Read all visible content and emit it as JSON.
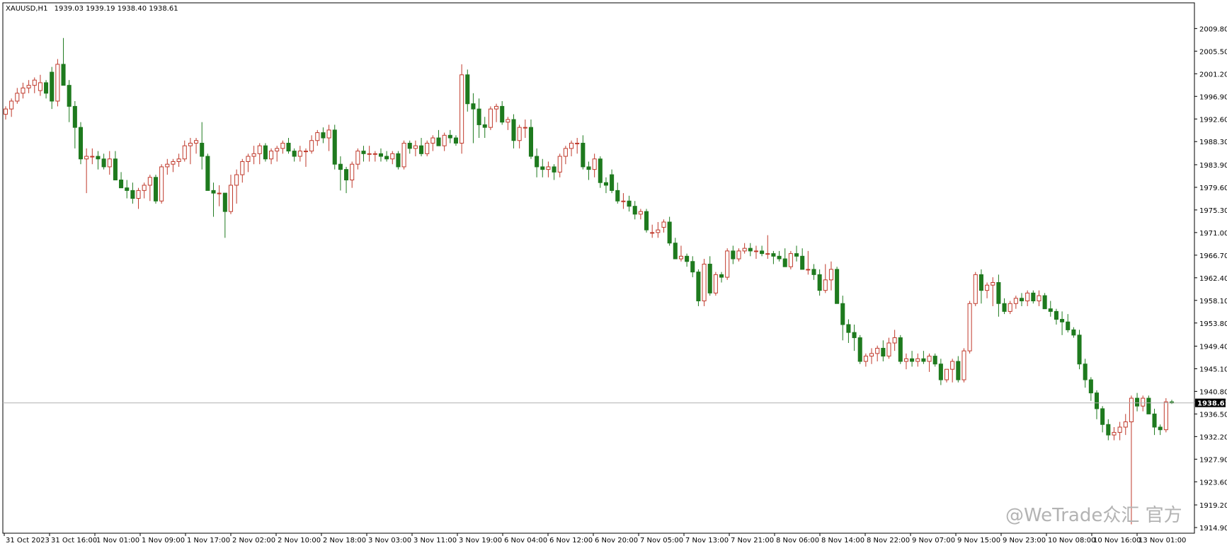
{
  "header": {
    "symbol": "XAUUSD,H1",
    "ohlc": "1939.03 1939.19 1938.40 1938.61"
  },
  "current_price_label": "1938.61",
  "watermark": "@WeTrade众汇 官方",
  "colors": {
    "bull": "#ffffff",
    "bull_border": "#c0392b",
    "bear": "#1e7a1e",
    "bear_border": "#1e7a1e",
    "current_line": "#b0b0b0",
    "price_box": "#000000"
  },
  "chart_data": {
    "type": "candlestick",
    "symbol": "XAUUSD",
    "timeframe": "H1",
    "ylim": [
      1914.9,
      2012.0
    ],
    "y_ticks": [
      "2009.80",
      "2005.50",
      "2001.20",
      "1996.90",
      "1992.60",
      "1988.30",
      "1983.90",
      "1979.60",
      "1975.30",
      "1971.00",
      "1966.70",
      "1962.40",
      "1958.10",
      "1953.80",
      "1949.40",
      "1945.10",
      "1940.80",
      "1936.50",
      "1932.20",
      "1927.90",
      "1923.60",
      "1919.20",
      "1914.90"
    ],
    "x_ticks": [
      "31 Oct 2023",
      "31 Oct 16:00",
      "1 Nov 01:00",
      "1 Nov 09:00",
      "1 Nov 17:00",
      "2 Nov 02:00",
      "2 Nov 10:00",
      "2 Nov 18:00",
      "3 Nov 03:00",
      "3 Nov 11:00",
      "3 Nov 19:00",
      "6 Nov 04:00",
      "6 Nov 12:00",
      "6 Nov 20:00",
      "7 Nov 05:00",
      "7 Nov 13:00",
      "7 Nov 21:00",
      "8 Nov 06:00",
      "8 Nov 14:00",
      "8 Nov 22:00",
      "9 Nov 07:00",
      "9 Nov 15:00",
      "9 Nov 23:00",
      "10 Nov 08:00",
      "10 Nov 16:00",
      "13 Nov 01:00"
    ],
    "current_price": 1938.61,
    "candles": [
      [
        1993.5,
        1995.0,
        1992.5,
        1994.5
      ],
      [
        1994.5,
        1996.5,
        1993.0,
        1996.0
      ],
      [
        1996.0,
        1998.5,
        1995.5,
        1997.5
      ],
      [
        1997.5,
        1999.5,
        1996.5,
        1998.5
      ],
      [
        1998.5,
        2000.0,
        1997.5,
        1999.0
      ],
      [
        1999.0,
        2000.5,
        1997.5,
        2000.0
      ],
      [
        1998.0,
        2001.0,
        1997.0,
        1999.5
      ],
      [
        1999.5,
        2000.0,
        1996.5,
        1997.5
      ],
      [
        2001.5,
        2002.5,
        1994.5,
        1996.0
      ],
      [
        1996.0,
        2004.0,
        1995.0,
        2003.0
      ],
      [
        2003.0,
        2008.0,
        1999.0,
        1999.0
      ],
      [
        1999.0,
        2000.0,
        1992.0,
        1995.0
      ],
      [
        1995.0,
        1996.0,
        1987.0,
        1991.0
      ],
      [
        1991.0,
        1992.0,
        1984.0,
        1985.0
      ],
      [
        1985.0,
        1987.0,
        1978.5,
        1985.5
      ],
      [
        1985.5,
        1987.0,
        1984.0,
        1985.5
      ],
      [
        1985.5,
        1986.5,
        1983.0,
        1985.0
      ],
      [
        1985.0,
        1986.0,
        1983.0,
        1983.5
      ],
      [
        1983.5,
        1986.5,
        1982.0,
        1985.0
      ],
      [
        1985.0,
        1986.5,
        1981.0,
        1981.0
      ],
      [
        1981.0,
        1982.5,
        1979.5,
        1979.5
      ],
      [
        1979.5,
        1981.0,
        1977.5,
        1979.0
      ],
      [
        1979.0,
        1980.5,
        1976.5,
        1977.5
      ],
      [
        1977.5,
        1979.5,
        1975.5,
        1979.0
      ],
      [
        1979.0,
        1980.5,
        1977.5,
        1980.0
      ],
      [
        1980.0,
        1982.0,
        1977.0,
        1981.5
      ],
      [
        1981.5,
        1982.0,
        1976.5,
        1977.0
      ],
      [
        1977.0,
        1984.0,
        1976.5,
        1983.5
      ],
      [
        1983.5,
        1985.0,
        1982.0,
        1984.0
      ],
      [
        1984.0,
        1985.0,
        1982.5,
        1984.5
      ],
      [
        1984.5,
        1986.0,
        1983.5,
        1985.0
      ],
      [
        1985.0,
        1988.5,
        1984.5,
        1987.5
      ],
      [
        1987.5,
        1989.0,
        1984.0,
        1988.0
      ],
      [
        1988.0,
        1989.0,
        1986.0,
        1988.5
      ],
      [
        1988.0,
        1992.0,
        1983.0,
        1985.5
      ],
      [
        1985.5,
        1986.0,
        1980.0,
        1979.0
      ],
      [
        1979.0,
        1980.5,
        1974.0,
        1978.5
      ],
      [
        1978.5,
        1980.0,
        1976.0,
        1978.5
      ],
      [
        1978.5,
        1978.5,
        1970.0,
        1975.0
      ],
      [
        1975.0,
        1982.0,
        1974.5,
        1980.0
      ],
      [
        1980.0,
        1983.0,
        1976.5,
        1982.0
      ],
      [
        1982.0,
        1985.0,
        1980.5,
        1984.5
      ],
      [
        1984.5,
        1986.0,
        1982.5,
        1985.5
      ],
      [
        1985.5,
        1987.5,
        1984.0,
        1986.0
      ],
      [
        1986.0,
        1988.0,
        1984.0,
        1987.5
      ],
      [
        1987.5,
        1988.0,
        1984.5,
        1985.0
      ],
      [
        1985.0,
        1987.0,
        1984.0,
        1986.5
      ],
      [
        1986.5,
        1987.5,
        1984.5,
        1987.0
      ],
      [
        1987.0,
        1988.5,
        1986.0,
        1988.0
      ],
      [
        1988.0,
        1989.0,
        1986.0,
        1986.5
      ],
      [
        1986.5,
        1987.0,
        1984.5,
        1985.5
      ],
      [
        1985.5,
        1987.5,
        1984.5,
        1986.5
      ],
      [
        1986.5,
        1987.0,
        1983.5,
        1986.5
      ],
      [
        1986.5,
        1989.5,
        1986.0,
        1988.5
      ],
      [
        1988.5,
        1990.5,
        1987.5,
        1990.0
      ],
      [
        1990.0,
        1991.0,
        1988.0,
        1989.0
      ],
      [
        1989.0,
        1991.5,
        1986.5,
        1990.5
      ],
      [
        1990.5,
        1991.5,
        1983.0,
        1984.0
      ],
      [
        1984.0,
        1985.5,
        1979.0,
        1983.0
      ],
      [
        1983.0,
        1983.5,
        1978.5,
        1981.0
      ],
      [
        1981.0,
        1984.5,
        1979.5,
        1984.0
      ],
      [
        1984.0,
        1987.0,
        1983.0,
        1986.5
      ],
      [
        1986.5,
        1987.5,
        1984.5,
        1986.0
      ],
      [
        1986.0,
        1987.5,
        1984.5,
        1986.0
      ],
      [
        1986.0,
        1986.5,
        1984.5,
        1986.0
      ],
      [
        1986.0,
        1987.0,
        1984.5,
        1985.5
      ],
      [
        1985.5,
        1986.5,
        1984.5,
        1985.0
      ],
      [
        1985.0,
        1986.5,
        1984.0,
        1986.0
      ],
      [
        1986.0,
        1986.5,
        1983.0,
        1983.5
      ],
      [
        1983.5,
        1988.5,
        1983.0,
        1988.0
      ],
      [
        1988.0,
        1988.5,
        1986.0,
        1987.0
      ],
      [
        1987.0,
        1988.5,
        1985.5,
        1987.5
      ],
      [
        1987.5,
        1989.0,
        1985.5,
        1986.0
      ],
      [
        1986.0,
        1988.5,
        1985.5,
        1988.0
      ],
      [
        1988.0,
        1989.5,
        1986.5,
        1989.0
      ],
      [
        1989.0,
        1990.5,
        1987.5,
        1987.5
      ],
      [
        1987.5,
        1990.0,
        1986.5,
        1989.5
      ],
      [
        1989.5,
        1990.5,
        1988.0,
        1989.0
      ],
      [
        1989.0,
        1989.5,
        1987.5,
        1988.0
      ],
      [
        1988.0,
        2003.0,
        1986.0,
        2001.0
      ],
      [
        2001.0,
        2002.0,
        1994.0,
        1995.5
      ],
      [
        1995.5,
        1997.5,
        1988.0,
        1994.5
      ],
      [
        1994.5,
        1996.5,
        1989.0,
        1991.5
      ],
      [
        1991.5,
        1993.0,
        1989.0,
        1991.0
      ],
      [
        1991.0,
        1995.0,
        1990.5,
        1994.5
      ],
      [
        1994.5,
        1995.5,
        1992.0,
        1995.0
      ],
      [
        1995.0,
        1996.0,
        1991.5,
        1992.0
      ],
      [
        1992.0,
        1993.0,
        1990.5,
        1992.5
      ],
      [
        1992.5,
        1993.5,
        1987.0,
        1988.5
      ],
      [
        1988.5,
        1991.5,
        1987.0,
        1991.0
      ],
      [
        1991.0,
        1992.5,
        1989.0,
        1991.0
      ],
      [
        1991.0,
        1992.5,
        1985.0,
        1985.5
      ],
      [
        1985.5,
        1987.0,
        1981.5,
        1983.5
      ],
      [
        1983.5,
        1985.0,
        1981.5,
        1983.0
      ],
      [
        1983.0,
        1984.5,
        1981.5,
        1983.5
      ],
      [
        1983.5,
        1984.0,
        1981.0,
        1982.5
      ],
      [
        1982.5,
        1986.0,
        1981.5,
        1985.5
      ],
      [
        1985.5,
        1987.5,
        1984.0,
        1987.0
      ],
      [
        1987.0,
        1988.5,
        1985.5,
        1988.0
      ],
      [
        1988.0,
        1989.0,
        1986.0,
        1988.0
      ],
      [
        1988.0,
        1989.5,
        1983.0,
        1983.5
      ],
      [
        1983.5,
        1984.5,
        1981.0,
        1983.0
      ],
      [
        1983.0,
        1986.0,
        1981.5,
        1985.0
      ],
      [
        1985.0,
        1985.5,
        1979.5,
        1980.5
      ],
      [
        1980.5,
        1981.5,
        1978.5,
        1980.0
      ],
      [
        1982.0,
        1983.0,
        1978.5,
        1979.0
      ],
      [
        1979.0,
        1980.5,
        1976.5,
        1977.0
      ],
      [
        1977.0,
        1978.5,
        1975.5,
        1977.0
      ],
      [
        1977.0,
        1978.0,
        1975.0,
        1976.0
      ],
      [
        1976.0,
        1977.0,
        1973.5,
        1974.5
      ],
      [
        1974.5,
        1975.5,
        1973.5,
        1975.0
      ],
      [
        1975.0,
        1975.5,
        1971.0,
        1971.5
      ],
      [
        1971.0,
        1972.5,
        1970.0,
        1971.0
      ],
      [
        1971.0,
        1973.0,
        1970.0,
        1971.5
      ],
      [
        1972.0,
        1973.5,
        1971.0,
        1973.0
      ],
      [
        1973.0,
        1974.0,
        1968.5,
        1969.0
      ],
      [
        1969.0,
        1970.0,
        1966.0,
        1966.0
      ],
      [
        1966.0,
        1968.5,
        1965.5,
        1966.5
      ],
      [
        1966.5,
        1967.0,
        1964.5,
        1965.5
      ],
      [
        1965.5,
        1966.5,
        1962.5,
        1963.5
      ],
      [
        1963.5,
        1964.0,
        1957.0,
        1958.0
      ],
      [
        1958.0,
        1966.0,
        1957.0,
        1965.0
      ],
      [
        1965.0,
        1966.5,
        1959.0,
        1959.5
      ],
      [
        1959.5,
        1963.5,
        1959.0,
        1963.0
      ],
      [
        1963.0,
        1963.5,
        1961.5,
        1962.5
      ],
      [
        1962.5,
        1968.0,
        1962.0,
        1967.5
      ],
      [
        1967.5,
        1968.5,
        1965.0,
        1966.0
      ],
      [
        1966.0,
        1968.0,
        1965.5,
        1967.5
      ],
      [
        1967.5,
        1969.0,
        1967.0,
        1968.0
      ],
      [
        1968.0,
        1969.0,
        1966.5,
        1967.5
      ],
      [
        1967.5,
        1968.5,
        1966.0,
        1967.5
      ],
      [
        1967.5,
        1968.5,
        1966.5,
        1967.0
      ],
      [
        1967.0,
        1970.5,
        1966.0,
        1967.0
      ],
      [
        1967.0,
        1967.5,
        1965.0,
        1966.5
      ],
      [
        1966.5,
        1967.5,
        1965.5,
        1966.0
      ],
      [
        1966.0,
        1968.0,
        1964.5,
        1964.5
      ],
      [
        1964.5,
        1967.5,
        1964.0,
        1967.0
      ],
      [
        1967.0,
        1968.5,
        1965.5,
        1966.5
      ],
      [
        1966.5,
        1968.0,
        1964.0,
        1964.0
      ],
      [
        1964.0,
        1967.5,
        1963.0,
        1964.0
      ],
      [
        1964.0,
        1965.0,
        1962.0,
        1963.0
      ],
      [
        1963.0,
        1964.0,
        1959.0,
        1960.0
      ],
      [
        1960.0,
        1965.0,
        1959.5,
        1962.0
      ],
      [
        1962.0,
        1965.5,
        1960.0,
        1964.0
      ],
      [
        1964.0,
        1964.5,
        1957.5,
        1957.5
      ],
      [
        1957.5,
        1959.0,
        1950.5,
        1953.5
      ],
      [
        1953.5,
        1954.5,
        1950.0,
        1952.0
      ],
      [
        1952.0,
        1953.5,
        1948.5,
        1951.0
      ],
      [
        1951.0,
        1951.5,
        1946.0,
        1946.5
      ],
      [
        1946.5,
        1948.0,
        1945.5,
        1947.5
      ],
      [
        1947.5,
        1949.0,
        1946.0,
        1948.0
      ],
      [
        1948.0,
        1949.5,
        1946.5,
        1949.0
      ],
      [
        1949.0,
        1950.5,
        1946.5,
        1947.5
      ],
      [
        1947.5,
        1951.0,
        1947.0,
        1950.0
      ],
      [
        1950.0,
        1952.5,
        1948.5,
        1951.0
      ],
      [
        1951.0,
        1951.5,
        1946.0,
        1946.5
      ],
      [
        1946.5,
        1948.0,
        1945.0,
        1947.0
      ],
      [
        1947.0,
        1948.5,
        1945.5,
        1946.5
      ],
      [
        1946.5,
        1948.0,
        1945.5,
        1947.0
      ],
      [
        1947.0,
        1948.5,
        1946.0,
        1946.5
      ],
      [
        1946.5,
        1948.0,
        1944.5,
        1947.5
      ],
      [
        1947.5,
        1948.0,
        1945.5,
        1946.0
      ],
      [
        1946.0,
        1947.0,
        1942.0,
        1943.0
      ],
      [
        1943.0,
        1945.0,
        1942.5,
        1945.0
      ],
      [
        1945.0,
        1947.0,
        1942.5,
        1946.5
      ],
      [
        1946.5,
        1947.5,
        1942.5,
        1943.0
      ],
      [
        1943.0,
        1949.0,
        1942.5,
        1948.5
      ],
      [
        1948.5,
        1958.0,
        1948.0,
        1957.5
      ],
      [
        1957.5,
        1963.5,
        1957.0,
        1963.0
      ],
      [
        1963.0,
        1964.0,
        1957.5,
        1960.0
      ],
      [
        1960.0,
        1961.5,
        1958.5,
        1961.0
      ],
      [
        1961.0,
        1962.5,
        1957.0,
        1961.5
      ],
      [
        1961.5,
        1963.0,
        1955.0,
        1957.5
      ],
      [
        1957.5,
        1958.5,
        1955.5,
        1956.0
      ],
      [
        1956.0,
        1958.0,
        1955.5,
        1957.5
      ],
      [
        1957.5,
        1959.0,
        1956.5,
        1958.5
      ],
      [
        1958.5,
        1959.5,
        1957.0,
        1958.0
      ],
      [
        1958.0,
        1960.0,
        1957.0,
        1959.5
      ],
      [
        1959.5,
        1960.0,
        1957.5,
        1958.0
      ],
      [
        1958.0,
        1960.0,
        1957.0,
        1959.0
      ],
      [
        1959.0,
        1959.5,
        1956.5,
        1956.5
      ],
      [
        1956.5,
        1958.0,
        1955.0,
        1956.0
      ],
      [
        1956.0,
        1956.5,
        1953.5,
        1954.5
      ],
      [
        1954.5,
        1956.0,
        1951.5,
        1954.0
      ],
      [
        1954.0,
        1955.5,
        1952.0,
        1952.5
      ],
      [
        1952.5,
        1953.0,
        1951.0,
        1951.5
      ],
      [
        1951.5,
        1952.5,
        1945.0,
        1946.0
      ],
      [
        1946.0,
        1947.0,
        1941.5,
        1943.0
      ],
      [
        1943.0,
        1943.5,
        1939.0,
        1940.5
      ],
      [
        1940.5,
        1941.0,
        1935.5,
        1937.5
      ],
      [
        1937.5,
        1938.0,
        1933.0,
        1934.5
      ],
      [
        1934.5,
        1935.5,
        1931.5,
        1932.5
      ],
      [
        1932.5,
        1934.0,
        1931.5,
        1933.0
      ],
      [
        1933.0,
        1935.0,
        1931.5,
        1934.0
      ],
      [
        1934.0,
        1936.5,
        1932.5,
        1935.0
      ],
      [
        1935.0,
        1940.0,
        1915.5,
        1939.5
      ],
      [
        1939.5,
        1940.5,
        1937.0,
        1938.0
      ],
      [
        1938.0,
        1940.0,
        1937.0,
        1939.5
      ],
      [
        1939.5,
        1940.0,
        1936.5,
        1936.5
      ],
      [
        1936.5,
        1937.5,
        1932.5,
        1934.0
      ],
      [
        1934.0,
        1934.5,
        1932.5,
        1933.5
      ],
      [
        1933.5,
        1939.5,
        1933.0,
        1938.8
      ],
      [
        1938.8,
        1939.2,
        1938.4,
        1938.6
      ]
    ]
  }
}
